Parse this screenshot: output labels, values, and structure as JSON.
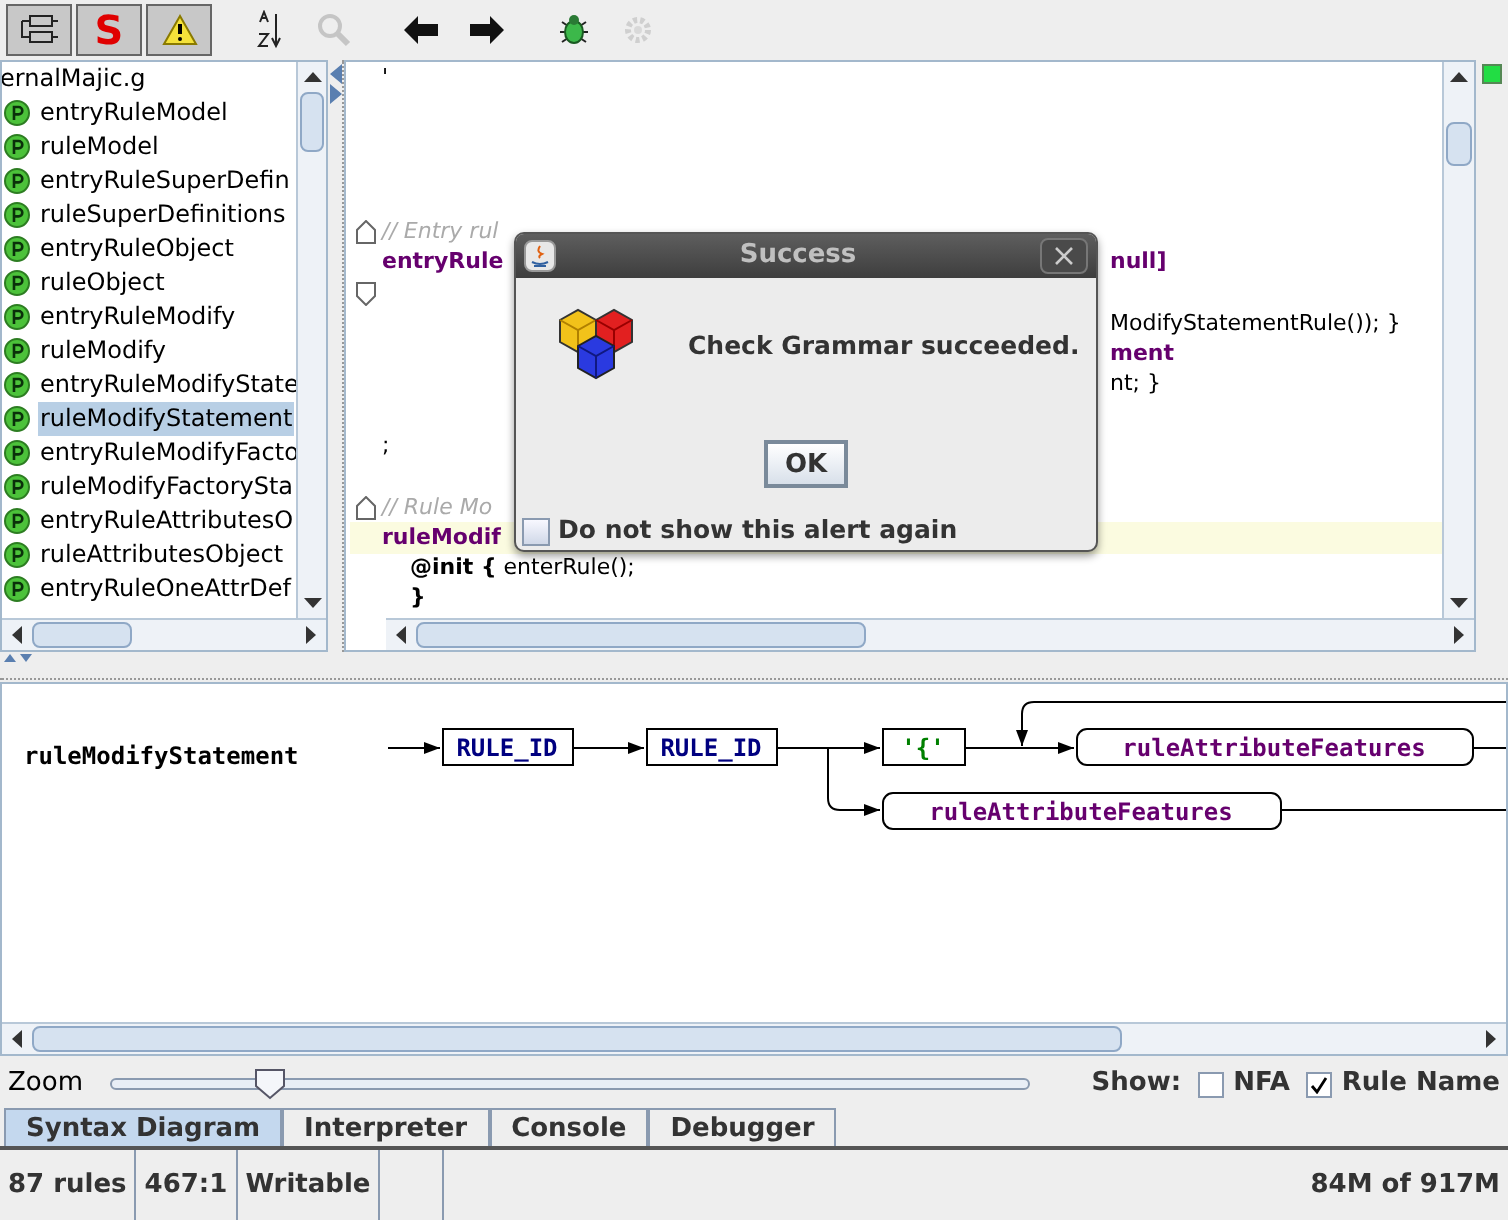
{
  "toolbar": [
    {
      "kind": "rules-view",
      "disabled": false
    },
    {
      "kind": "syntax",
      "label": "S",
      "disabled": false
    },
    {
      "kind": "warning",
      "disabled": false
    },
    {
      "kind": "sort",
      "disabled": false
    },
    {
      "kind": "find",
      "disabled": true
    },
    {
      "kind": "back",
      "disabled": false
    },
    {
      "kind": "forward",
      "disabled": false
    },
    {
      "kind": "debug",
      "disabled": false
    },
    {
      "kind": "gear",
      "disabled": true
    }
  ],
  "rules_tree": {
    "file": "ernalMajic.g",
    "items": [
      {
        "label": "entryRuleModel",
        "selected": false
      },
      {
        "label": "ruleModel",
        "selected": false
      },
      {
        "label": "entryRuleSuperDefin",
        "selected": false
      },
      {
        "label": "ruleSuperDefinitions",
        "selected": false
      },
      {
        "label": "entryRuleObject",
        "selected": false
      },
      {
        "label": "ruleObject",
        "selected": false
      },
      {
        "label": "entryRuleModify",
        "selected": false
      },
      {
        "label": "ruleModify",
        "selected": false
      },
      {
        "label": "entryRuleModifyState",
        "selected": false
      },
      {
        "label": "ruleModifyStatement",
        "selected": true
      },
      {
        "label": "entryRuleModifyFacto",
        "selected": false
      },
      {
        "label": "ruleModifyFactorySta",
        "selected": false
      },
      {
        "label": "entryRuleAttributesO",
        "selected": false
      },
      {
        "label": "ruleAttributesObject",
        "selected": false
      },
      {
        "label": "entryRuleOneAttrDef",
        "selected": false
      }
    ]
  },
  "editor": {
    "lines": [
      {
        "kind": "plain",
        "left": "'",
        "fold": false,
        "current": false
      },
      {
        "kind": "blank",
        "fold": false,
        "current": false
      },
      {
        "kind": "blank",
        "fold": false,
        "current": false
      },
      {
        "kind": "blank",
        "fold": false,
        "current": false
      },
      {
        "kind": "blank",
        "fold": false,
        "current": false
      },
      {
        "kind": "comment",
        "left": "// Entry rul",
        "fold": true,
        "current": false
      },
      {
        "kind": "rule",
        "left": "entryRule",
        "right": "null]",
        "fold": false,
        "current": false
      },
      {
        "kind": "blank",
        "fold": true,
        "current": false
      },
      {
        "kind": "plain",
        "right": "ModifyStatementRule()); }",
        "fold": false,
        "current": false
      },
      {
        "kind": "rule",
        "right": "ment",
        "fold": false,
        "current": false
      },
      {
        "kind": "plain",
        "right": "nt; }",
        "fold": false,
        "current": false
      },
      {
        "kind": "blank",
        "fold": false,
        "current": false
      },
      {
        "kind": "plain",
        "left": ";",
        "fold": false,
        "current": false
      },
      {
        "kind": "blank",
        "fold": false,
        "current": false
      },
      {
        "kind": "comment",
        "left": "// Rule Mo",
        "fold": true,
        "current": false
      },
      {
        "kind": "rule",
        "left": "ruleModif",
        "fold": false,
        "current": true
      },
      {
        "kind": "plain",
        "left": "    **@init {** enterRule();",
        "fold": false,
        "current": false
      },
      {
        "kind": "plain",
        "left": "    **}**",
        "fold": false,
        "current": false
      }
    ]
  },
  "dialog": {
    "title": "Success",
    "message": "Check Grammar succeeded.",
    "button": "OK",
    "checkbox": {
      "label": "Do not show this alert again",
      "checked": false
    }
  },
  "diagram": {
    "rule_name": "ruleModifyStatement",
    "nodes": [
      {
        "kind": "token",
        "label": "RULE_ID"
      },
      {
        "kind": "token",
        "label": "RULE_ID"
      },
      {
        "kind": "literal",
        "label": "'{'"
      },
      {
        "kind": "rule",
        "label": "ruleAttributeFeatures"
      },
      {
        "kind": "rule",
        "label": "ruleAttributeFeatures"
      }
    ]
  },
  "zoom": {
    "label": "Zoom",
    "level": 0.16
  },
  "show": {
    "label": "Show:",
    "options": [
      {
        "label": "NFA",
        "checked": false
      },
      {
        "label": "Rule Name",
        "checked": true
      }
    ]
  },
  "tabs": [
    {
      "label": "Syntax Diagram",
      "selected": true
    },
    {
      "label": "Interpreter",
      "selected": false
    },
    {
      "label": "Console",
      "selected": false
    },
    {
      "label": "Debugger",
      "selected": false
    }
  ],
  "status_bar": {
    "cells": [
      "87 rules",
      "467:1",
      "Writable"
    ],
    "memory": "84M of 917M"
  }
}
